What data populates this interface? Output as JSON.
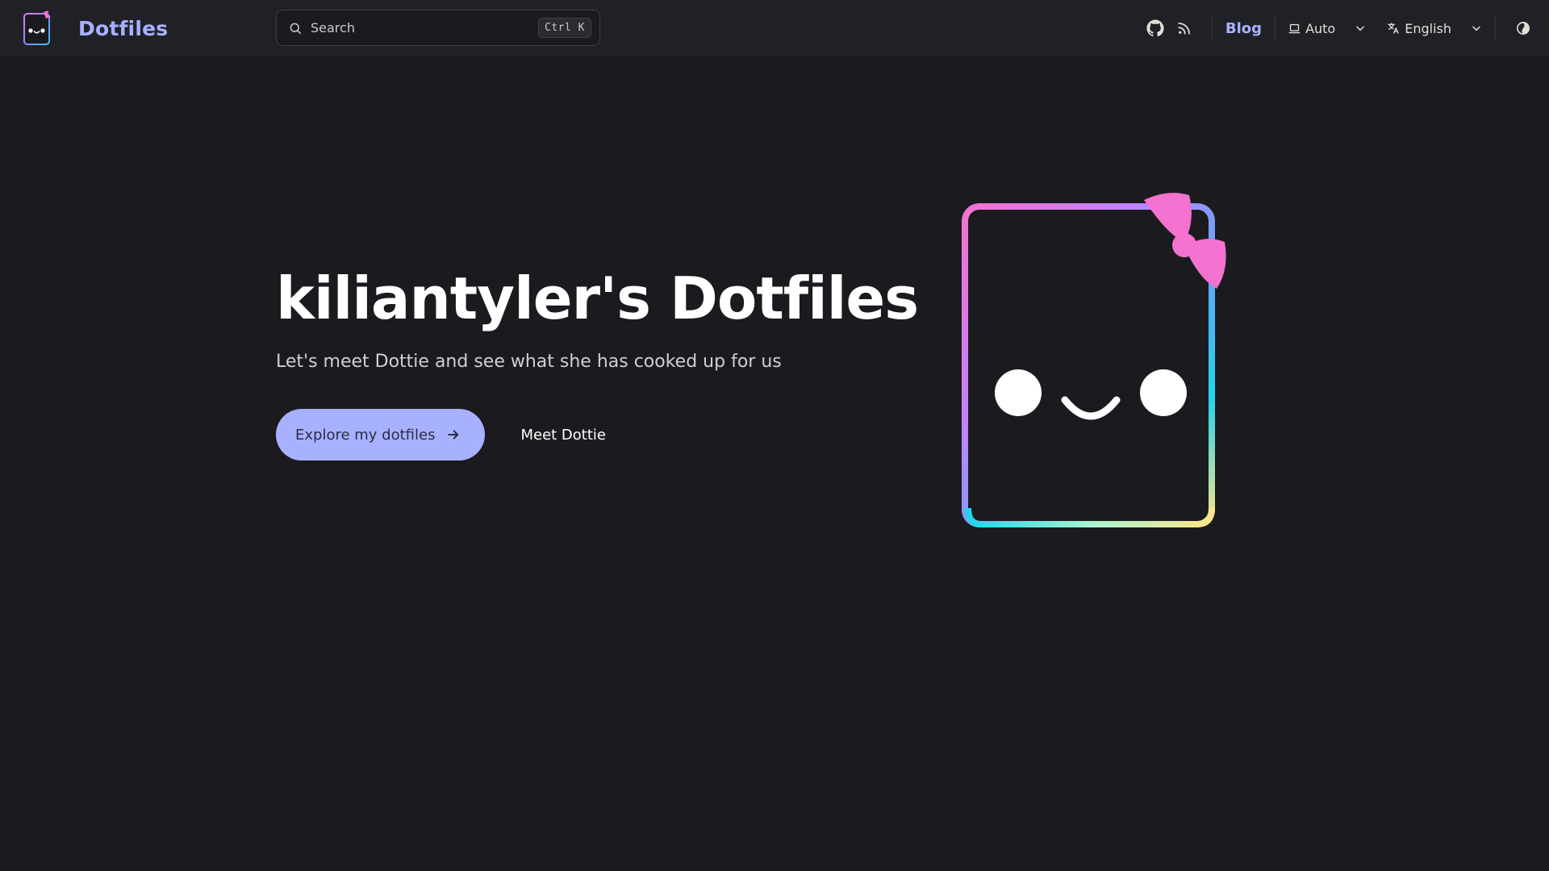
{
  "site": {
    "title": "Dotfiles"
  },
  "search": {
    "placeholder": "Search",
    "shortcut": "Ctrl K"
  },
  "nav": {
    "blog_label": "Blog",
    "appearance_label": "Auto",
    "language_label": "English"
  },
  "hero": {
    "title": "kiliantyler's Dotfiles",
    "tagline": "Let's meet Dottie and see what she has cooked up for us",
    "primary_action": "Explore my dotfiles",
    "secondary_action": "Meet Dottie"
  },
  "colors": {
    "brand": "#a8b1ff",
    "background": "#1b1b1f",
    "nav_background": "#202127",
    "bow": "#f472d0"
  },
  "icons": {
    "github": "github-icon",
    "rss": "rss-icon",
    "appearance": "monitor-icon",
    "language": "translate-icon",
    "theme": "theme-toggle-icon"
  }
}
